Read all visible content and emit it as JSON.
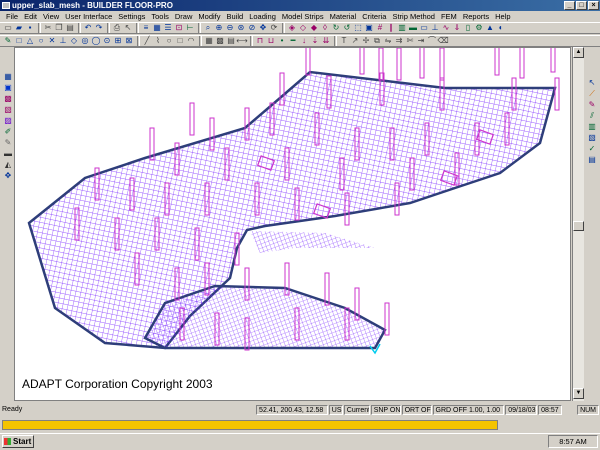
{
  "window": {
    "title": "upper_slab_mesh - BUILDER FLOOR-PRO"
  },
  "menubar": {
    "items": [
      "File",
      "Edit",
      "View",
      "User Interface",
      "Settings",
      "Tools",
      "Draw",
      "Modify",
      "Build",
      "Loading",
      "Model Strips",
      "Material",
      "Criteria",
      "Strip Method",
      "FEM",
      "Reports",
      "Help"
    ]
  },
  "canvas": {
    "copyright": "ADAPT Corporation Copyright 2003",
    "colors": {
      "mesh": "#7b2cff",
      "columns": "#cc33cc",
      "edge": "#2e3e7a"
    }
  },
  "status": {
    "ready": "Ready",
    "coords": "52.41, 200.43, 12.58",
    "units": "US",
    "plane": "Current",
    "snap": "SNP ON",
    "ortho": "ORT OFF",
    "grid": "GRD OFF 1.00, 1.00",
    "date": "09/18/03",
    "time": "08:57",
    "num": "NUM"
  },
  "taskbar": {
    "start_label": "Start",
    "clock": "8:57 AM"
  }
}
